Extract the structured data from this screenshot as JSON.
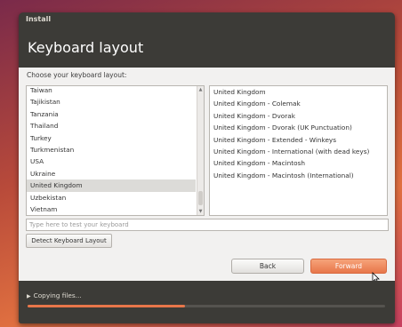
{
  "window": {
    "title": "Install"
  },
  "header": {
    "title": "Keyboard layout"
  },
  "prompt": "Choose your keyboard layout:",
  "layouts": [
    "Taiwan",
    "Tajikistan",
    "Tanzania",
    "Thailand",
    "Turkey",
    "Turkmenistan",
    "USA",
    "Ukraine",
    "United Kingdom",
    "Uzbekistan",
    "Vietnam"
  ],
  "selected_layout": "United Kingdom",
  "variants": [
    "United Kingdom",
    "United Kingdom - Colemak",
    "United Kingdom - Dvorak",
    "United Kingdom - Dvorak (UK Punctuation)",
    "United Kingdom - Extended - Winkeys",
    "United Kingdom - International (with dead keys)",
    "United Kingdom - Macintosh",
    "United Kingdom - Macintosh (International)"
  ],
  "test_input": {
    "placeholder": "Type here to test your keyboard",
    "value": ""
  },
  "buttons": {
    "detect": "Detect Keyboard Layout",
    "back": "Back",
    "forward": "Forward"
  },
  "progress": {
    "label": "Copying files...",
    "fraction": 0.44
  },
  "colors": {
    "accent": "#e8764a",
    "window_bg": "#3c3b37",
    "content_bg": "#f2f1f0"
  },
  "icons": {
    "expander": "triangle-right-icon",
    "cursor": "mouse-pointer-icon"
  }
}
